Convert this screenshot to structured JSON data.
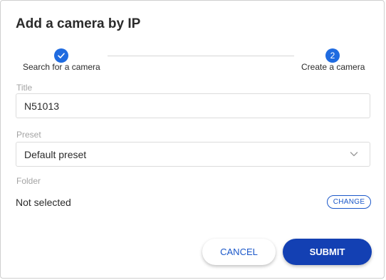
{
  "dialog": {
    "title": "Add a camera by IP"
  },
  "stepper": {
    "steps": [
      {
        "label": "Search for a camera",
        "state": "completed",
        "icon": "check-icon"
      },
      {
        "label": "Create a camera",
        "state": "active",
        "number": "2"
      }
    ],
    "accent_color": "#1f6be0"
  },
  "form": {
    "title_label": "Title",
    "title_value": "N51013",
    "preset_label": "Preset",
    "preset_value": "Default preset",
    "folder_label": "Folder",
    "folder_value": "Not selected",
    "change_label": "CHANGE"
  },
  "actions": {
    "cancel_label": "CANCEL",
    "submit_label": "SUBMIT",
    "primary_color": "#1340b3"
  }
}
